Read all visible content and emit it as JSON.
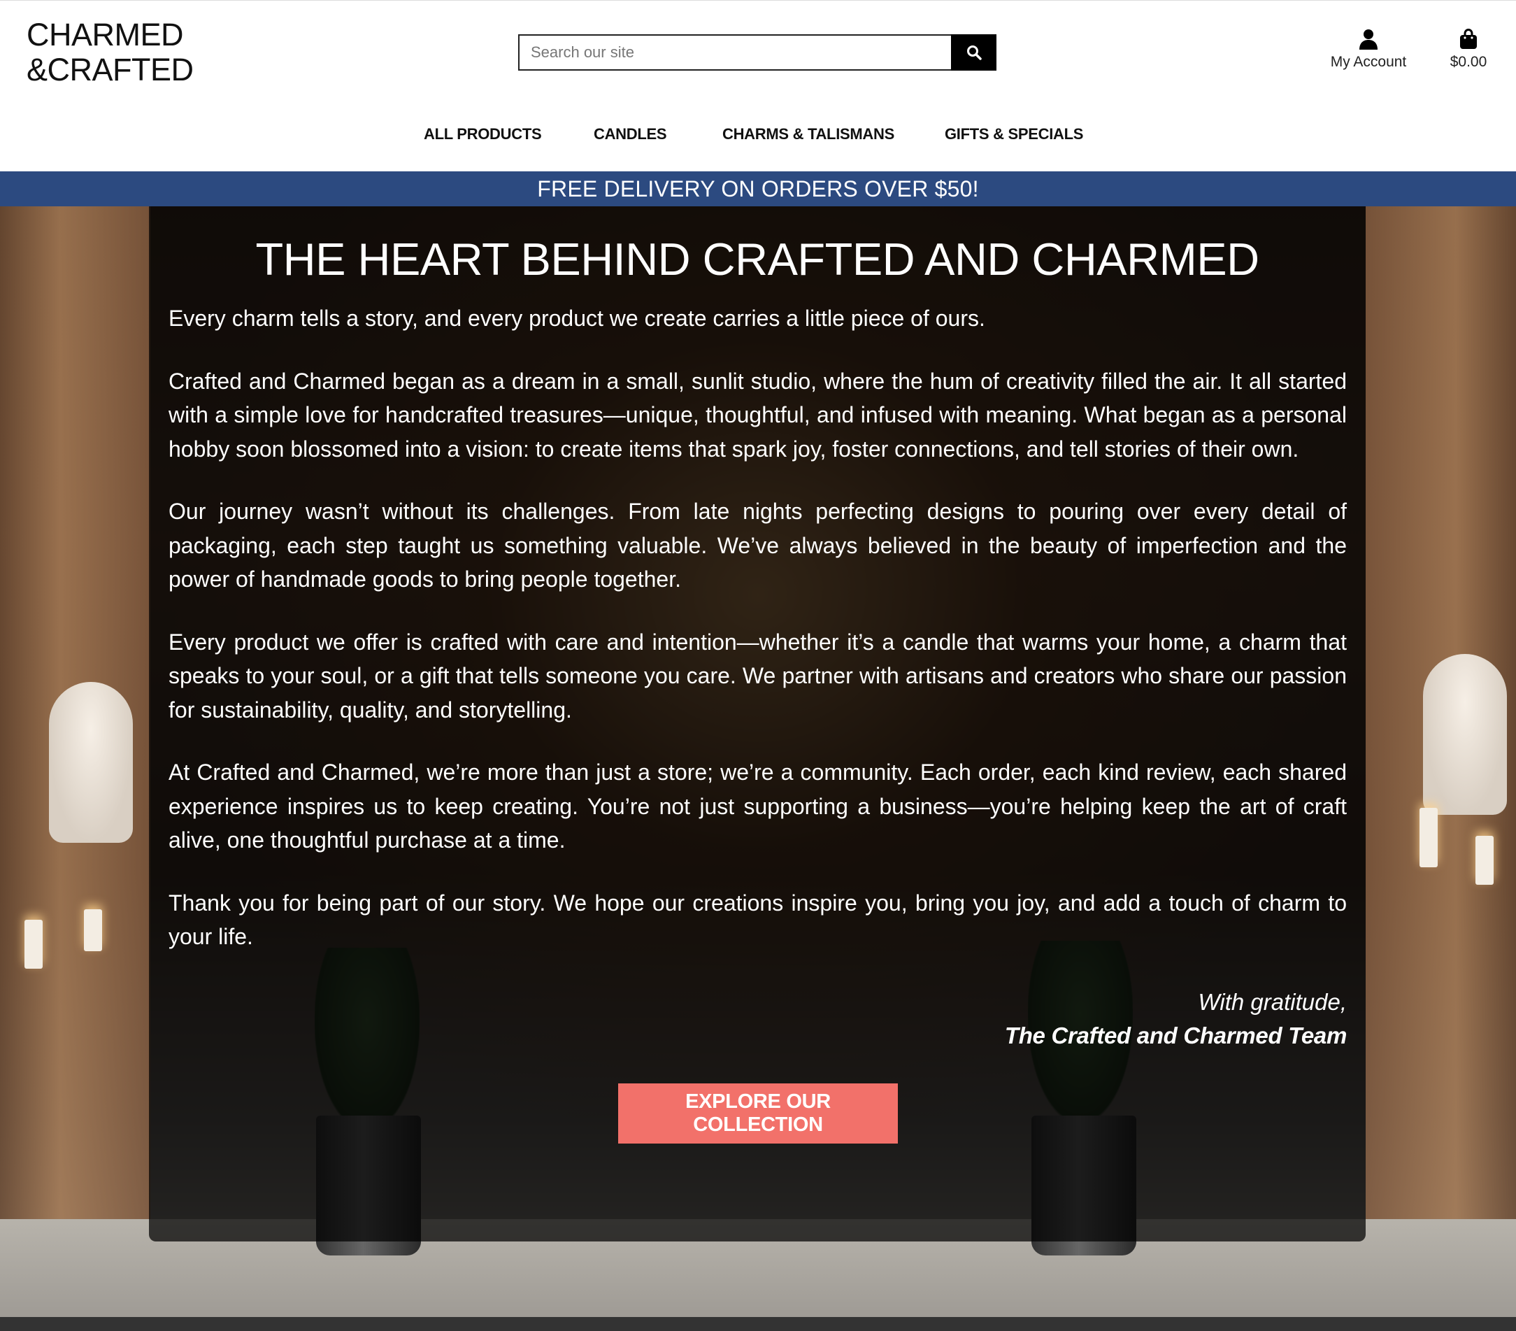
{
  "brand": {
    "line1": "CHARMED",
    "line2": "&CRAFTED"
  },
  "search": {
    "placeholder": "Search our site"
  },
  "account": {
    "label": "My Account"
  },
  "cart": {
    "total": "$0.00"
  },
  "nav": {
    "items": [
      {
        "label": "ALL PRODUCTS"
      },
      {
        "label": "CANDLES"
      },
      {
        "label": "CHARMS & TALISMANS"
      },
      {
        "label": "GIFTS & SPECIALS"
      }
    ]
  },
  "banner": {
    "text": "FREE DELIVERY ON ORDERS OVER $50!"
  },
  "about": {
    "title": "THE HEART BEHIND CRAFTED AND CHARMED",
    "paragraphs": [
      "Every charm tells a story, and every product we create carries a little piece of ours.",
      "Crafted and Charmed began as a dream in a small, sunlit studio, where the hum of creativity filled the air. It all started with a simple love for handcrafted treasures—unique, thoughtful, and infused with meaning. What began as a personal hobby soon blossomed into a vision: to create items that spark joy, foster connections, and tell stories of their own.",
      "Our journey wasn’t without its challenges. From late nights perfecting designs to pouring over every detail of packaging, each step taught us something valuable. We’ve always believed in the beauty of imperfection and the power of handmade goods to bring people together.",
      "Every product we offer is crafted with care and intention—whether it’s a candle that warms your home, a charm that speaks to your soul, or a gift that tells someone you care. We partner with artisans and creators who share our passion for sustainability, quality, and storytelling.",
      "At Crafted and Charmed, we’re more than just a store; we’re a community. Each order, each kind review, each shared experience inspires us to keep creating. You’re not just supporting a business—you’re helping keep the art of craft alive, one thoughtful purchase at a time.",
      "Thank you for being part of our story. We hope our creations inspire you, bring you joy, and add a touch of charm to your life."
    ],
    "signoff": "With gratitude,",
    "team": "The Crafted and Charmed Team",
    "cta_label": "EXPLORE OUR COLLECTION"
  },
  "colors": {
    "banner": "#2c4a80",
    "cta": "#f2716a"
  }
}
